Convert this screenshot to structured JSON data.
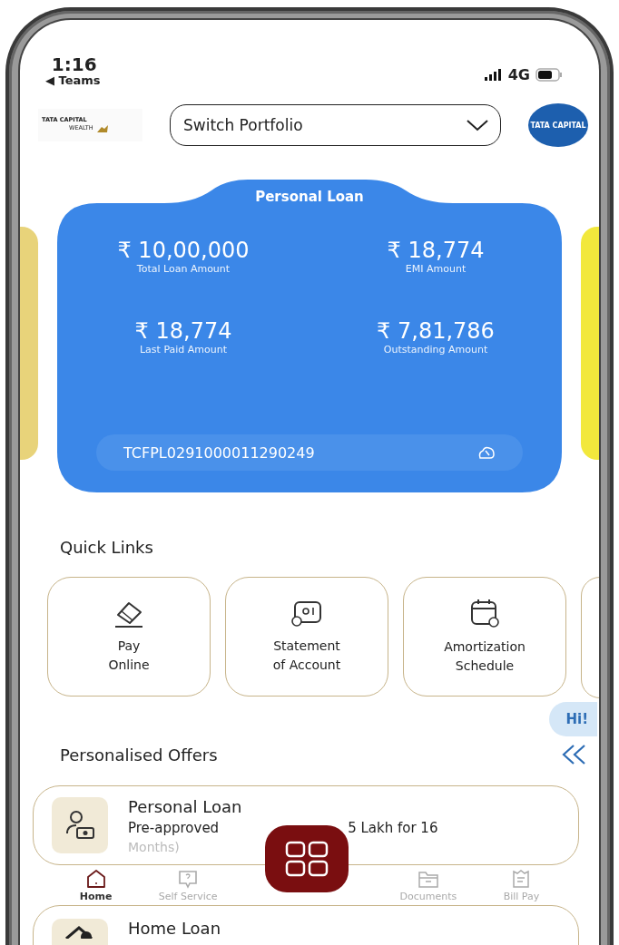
{
  "status_bar": {
    "time": "1:16",
    "back_label": "◀ Teams",
    "network": "4G"
  },
  "header": {
    "logo_text": [
      "TATA CAPITAL",
      "WEALTH"
    ],
    "portfolio_select": "Switch Portfolio",
    "avatar_text": "TATA CAPITAL"
  },
  "loan_card": {
    "title": "Personal Loan",
    "stats": [
      {
        "value": "₹ 10,00,000",
        "label": "Total Loan Amount"
      },
      {
        "value": "₹ 18,774",
        "label": "EMI Amount"
      },
      {
        "value": "₹ 18,774",
        "label": "Last Paid Amount"
      },
      {
        "value": "₹ 7,81,786",
        "label": "Outstanding Amount"
      }
    ],
    "account_number": "TCFPL0291000011290249"
  },
  "quick_links": {
    "title": "Quick Links",
    "items": [
      {
        "kind": "card",
        "lines": [
          "Pay",
          "Online"
        ]
      },
      {
        "kind": "statement",
        "lines": [
          "Statement",
          "of Account"
        ]
      },
      {
        "kind": "calendar",
        "lines": [
          "Amortization",
          "Schedule"
        ]
      }
    ]
  },
  "chat_bubble": "Hi!",
  "offers": {
    "title": "Personalised Offers",
    "items": [
      {
        "kind": "personal",
        "title": "Personal Loan",
        "text_before": "Pre-approved",
        "text_after": "5 Lakh for 16",
        "text_below": "Months)"
      },
      {
        "kind": "home",
        "title": "Home Loan"
      }
    ]
  },
  "bottom_nav": [
    {
      "kind": "home",
      "label": "Home",
      "selected": true
    },
    {
      "kind": "help",
      "label": "Self Service",
      "selected": false
    },
    {
      "kind": "docs",
      "label": "Documents",
      "selected": false
    },
    {
      "kind": "bill",
      "label": "Bill Pay",
      "selected": false
    }
  ]
}
